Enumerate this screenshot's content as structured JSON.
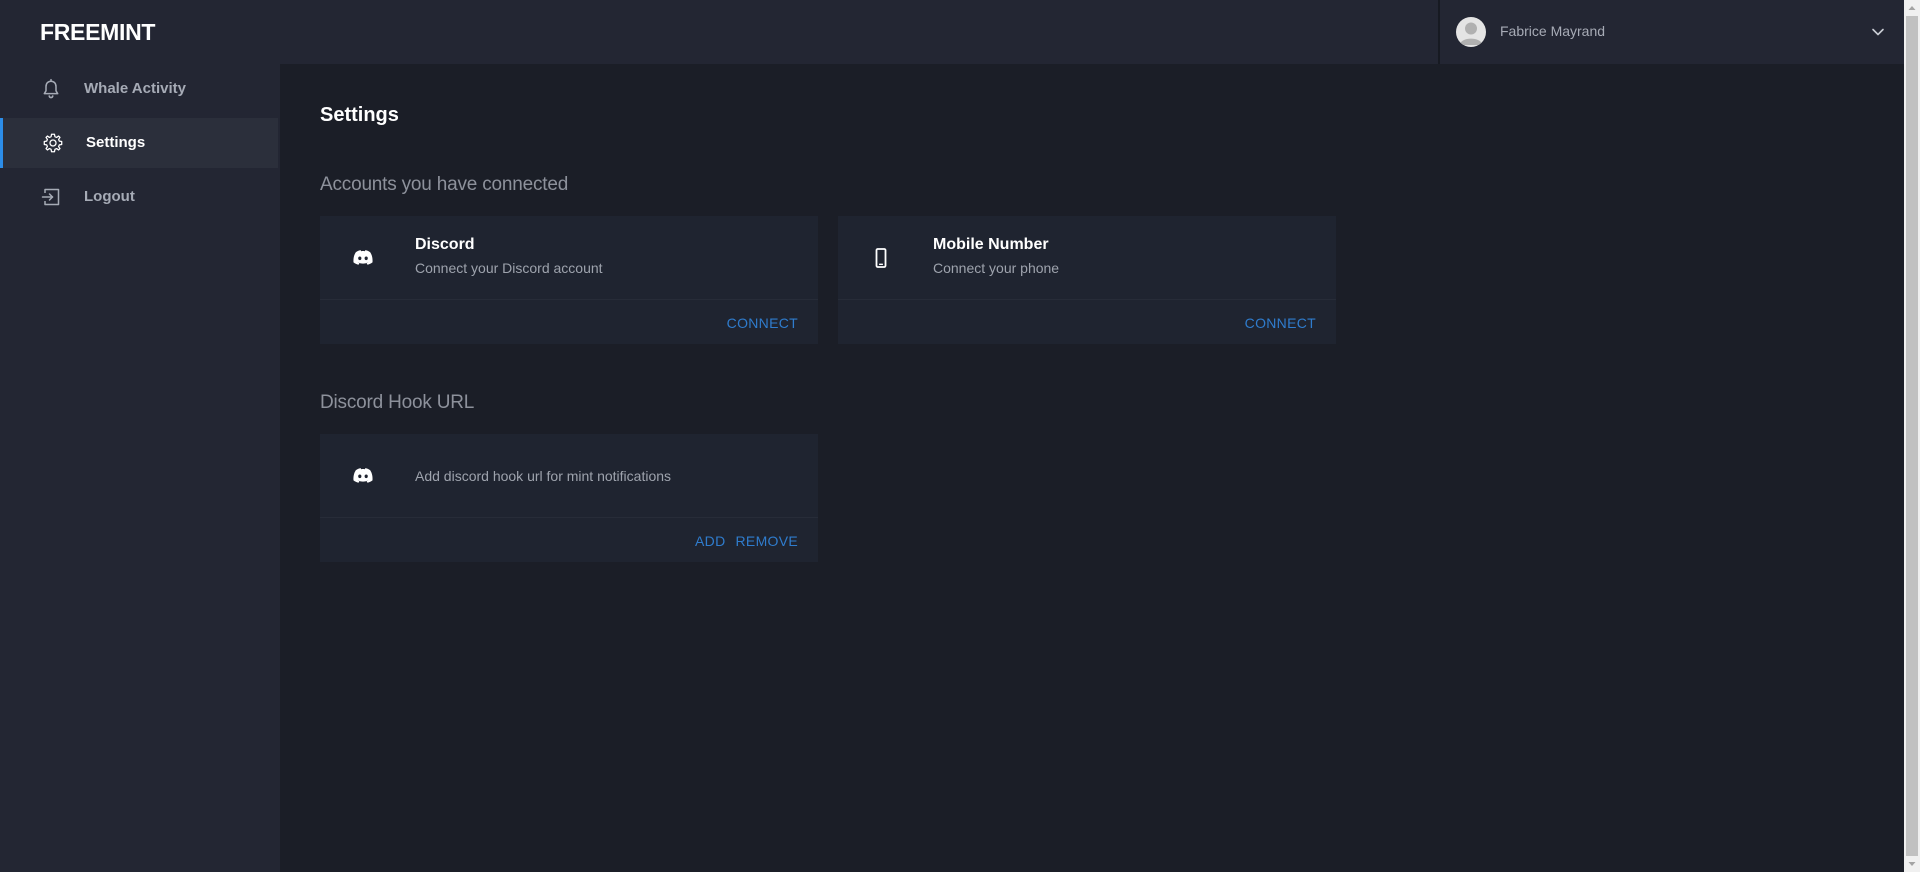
{
  "app": {
    "logo": "FREEMINT"
  },
  "user": {
    "name": "Fabrice Mayrand"
  },
  "sidebar": {
    "items": [
      {
        "label": "Whale Activity",
        "icon": "bell-icon"
      },
      {
        "label": "Settings",
        "icon": "gear-icon",
        "active": true
      },
      {
        "label": "Logout",
        "icon": "logout-icon"
      }
    ]
  },
  "main": {
    "title": "Settings",
    "accounts_section": {
      "title": "Accounts you have connected",
      "cards": [
        {
          "icon": "discord-icon",
          "title": "Discord",
          "subtitle": "Connect your Discord account",
          "action": "CONNECT"
        },
        {
          "icon": "phone-icon",
          "title": "Mobile Number",
          "subtitle": "Connect your phone",
          "action": "CONNECT"
        }
      ]
    },
    "hook_section": {
      "title": "Discord Hook URL",
      "card": {
        "icon": "discord-icon",
        "description": "Add discord hook url for mint notifications",
        "add_label": "ADD",
        "remove_label": "REMOVE"
      }
    }
  },
  "colors": {
    "accent": "#2c8de8",
    "link": "#2f7ccd",
    "background": "#1b1e27",
    "panel": "#232633",
    "card": "#1f2430"
  }
}
